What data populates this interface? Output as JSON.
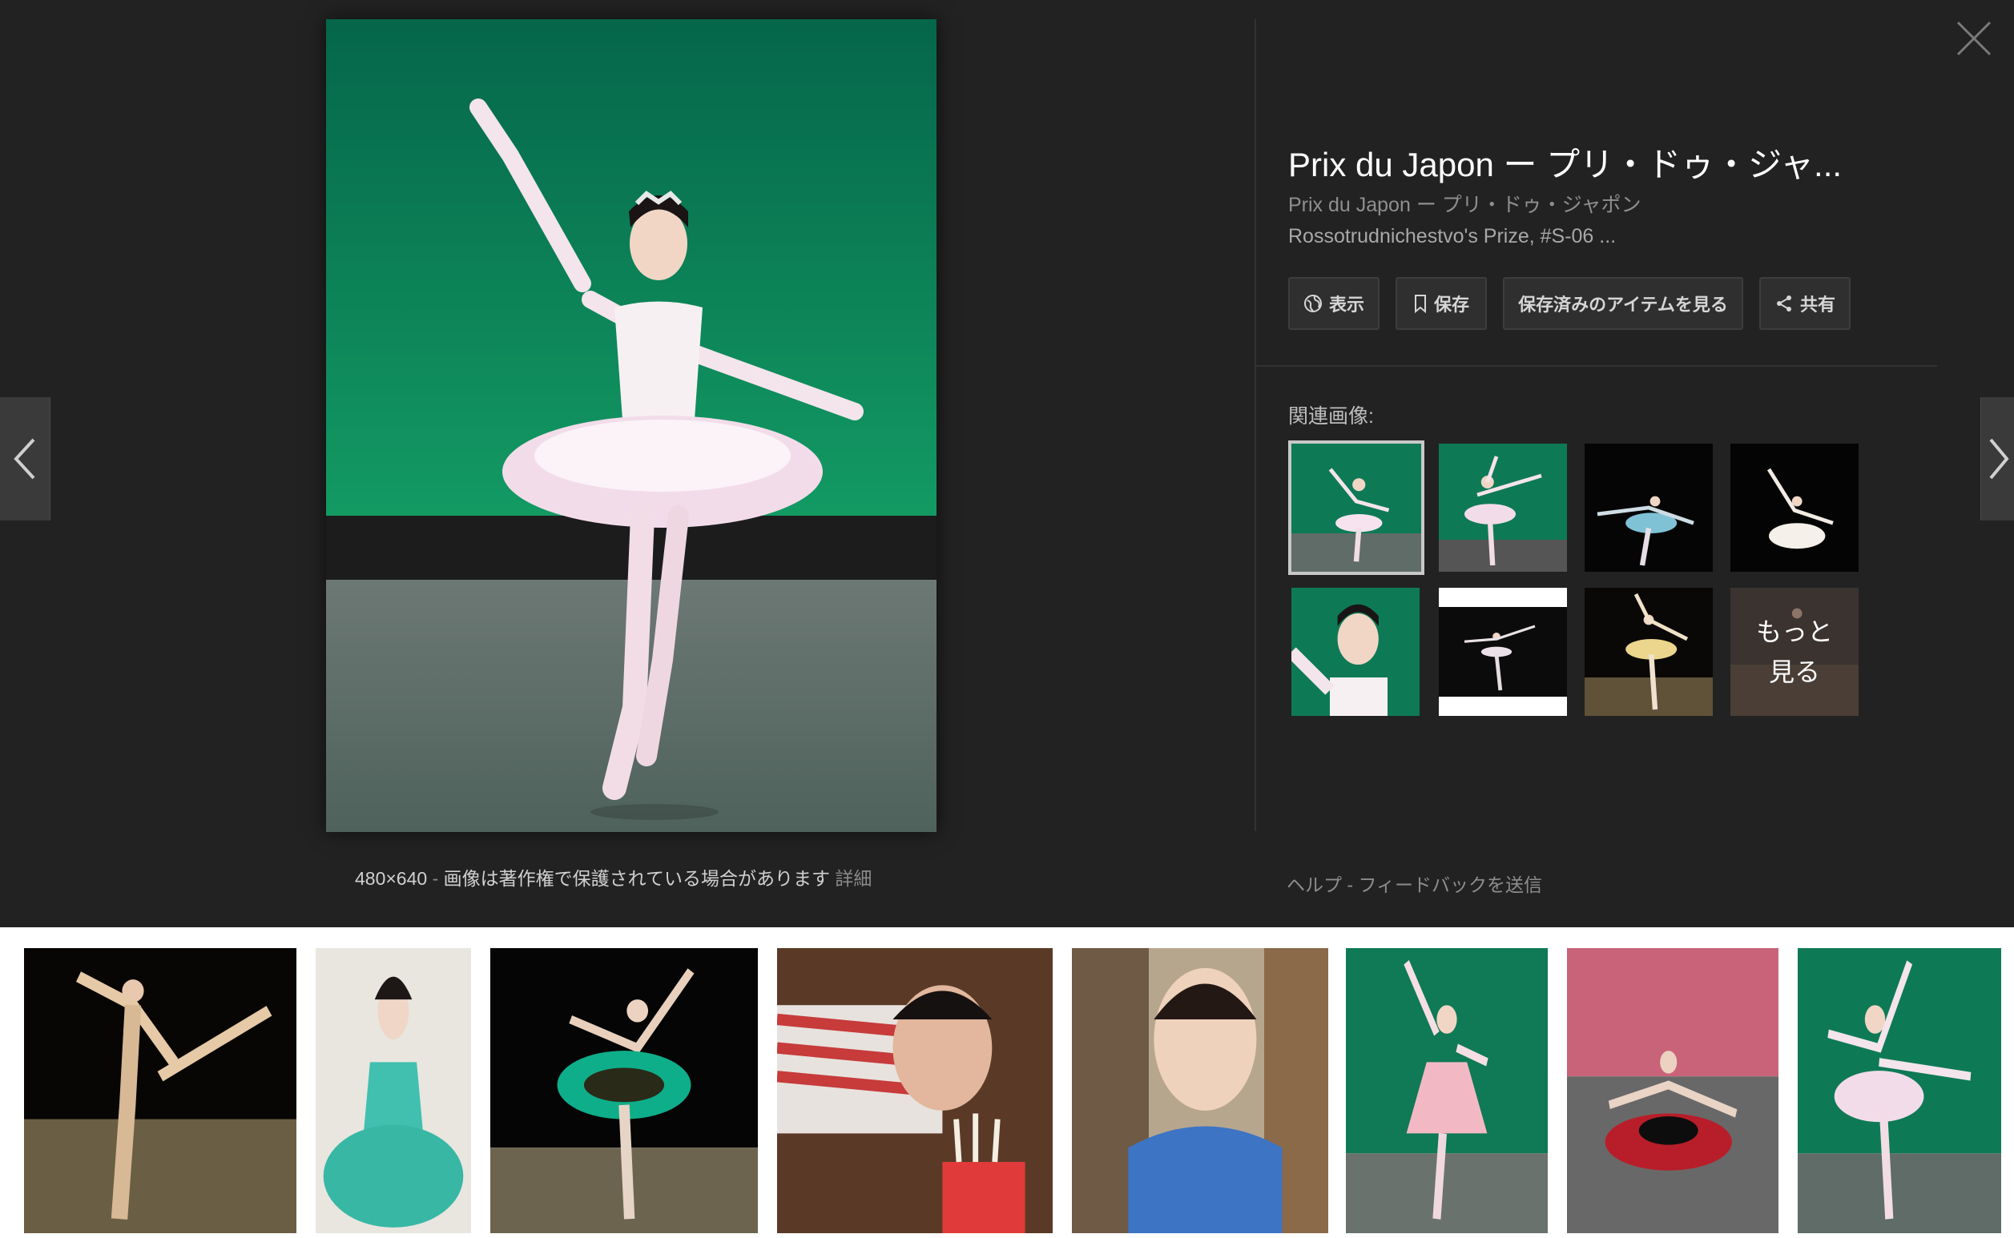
{
  "viewer": {
    "title": "Prix du Japon ー プリ・ドゥ・ジャ...",
    "subtitle": "Prix du Japon ー プリ・ドゥ・ジャポン",
    "description": "Rossotrudnichestvo's Prize, #S-06 ...",
    "actions": {
      "view": "表示",
      "save": "保存",
      "saved_items": "保存済みのアイテムを見る",
      "share": "共有"
    },
    "related_label": "関連画像:",
    "more_label_1": "もっと",
    "more_label_2": "見る",
    "caption": {
      "dimensions": "480×640",
      "separator": "-",
      "copyright": "画像は著作権で保護されている場合があります",
      "details": "詳細"
    },
    "footer": {
      "help": "ヘルプ",
      "separator": "-",
      "feedback": "フィードバックを送信"
    }
  },
  "icons": {
    "prev": "chevron-left-icon",
    "next": "chevron-right-icon",
    "close": "close-icon",
    "view": "globe-icon",
    "save": "bookmark-icon",
    "share": "share-icon"
  },
  "colors": {
    "viewer_bg": "#222222",
    "stage_green": "#0e7a55",
    "button_bg": "#2f2f2f"
  }
}
